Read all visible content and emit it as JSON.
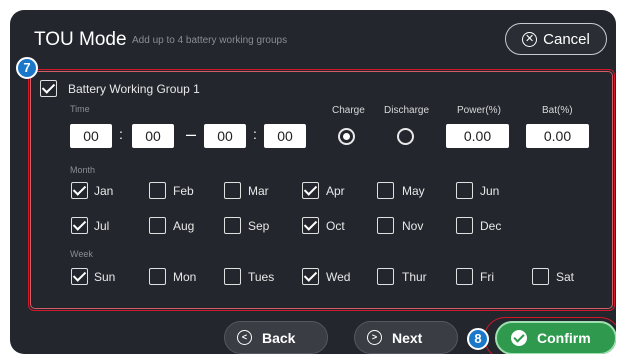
{
  "header": {
    "title": "TOU Mode",
    "subtitle": "Add up to 4 battery working groups",
    "cancel_label": "Cancel"
  },
  "badges": {
    "group": "7",
    "confirm": "8"
  },
  "group": {
    "label": "Battery Working Group 1",
    "checked": true,
    "time_label": "Time",
    "start_hour": "00",
    "start_min": "00",
    "end_hour": "00",
    "end_min": "00",
    "charge_label": "Charge",
    "discharge_label": "Discharge",
    "power_label": "Power(%)",
    "bat_label": "Bat(%)",
    "power_value": "0.00",
    "bat_value": "0.00",
    "mode_selected": "Charge"
  },
  "month": {
    "label": "Month",
    "items": [
      {
        "label": "Jan",
        "checked": true
      },
      {
        "label": "Feb",
        "checked": false
      },
      {
        "label": "Mar",
        "checked": false
      },
      {
        "label": "Apr",
        "checked": true
      },
      {
        "label": "May",
        "checked": false
      },
      {
        "label": "Jun",
        "checked": false
      },
      {
        "label": "Jul",
        "checked": true
      },
      {
        "label": "Aug",
        "checked": false
      },
      {
        "label": "Sep",
        "checked": false
      },
      {
        "label": "Oct",
        "checked": true
      },
      {
        "label": "Nov",
        "checked": false
      },
      {
        "label": "Dec",
        "checked": false
      }
    ]
  },
  "week": {
    "label": "Week",
    "items": [
      {
        "label": "Sun",
        "checked": true
      },
      {
        "label": "Mon",
        "checked": false
      },
      {
        "label": "Tues",
        "checked": false
      },
      {
        "label": "Wed",
        "checked": true
      },
      {
        "label": "Thur",
        "checked": false
      },
      {
        "label": "Fri",
        "checked": false
      },
      {
        "label": "Sat",
        "checked": false
      }
    ]
  },
  "footer": {
    "back_label": "Back",
    "next_label": "Next",
    "confirm_label": "Confirm"
  },
  "colors": {
    "background": "#23262d",
    "highlight": "#d01828",
    "badge": "#1b78c8",
    "confirm": "#2f9a4e"
  }
}
